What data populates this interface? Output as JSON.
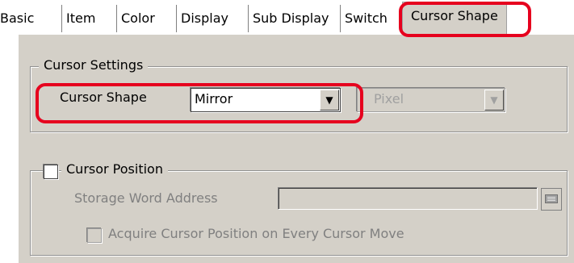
{
  "tabs": [
    {
      "label": "Basic"
    },
    {
      "label": "Item"
    },
    {
      "label": "Color"
    },
    {
      "label": "Display"
    },
    {
      "label": "Sub Display"
    },
    {
      "label": "Switch"
    },
    {
      "label": "Cursor Shape"
    }
  ],
  "cursor_settings": {
    "group_title": "Cursor Settings",
    "shape_label": "Cursor Shape",
    "shape_value": "Mirror",
    "unit_value": "Pixel"
  },
  "cursor_position": {
    "group_title": "Cursor Position",
    "storage_label": "Storage Word Address",
    "storage_value": "",
    "acquire_label": "Acquire Cursor Position on Every Cursor Move"
  },
  "colors": {
    "highlight": "#e6001e",
    "dialog_bg": "#d4d0c8"
  },
  "icons": {
    "combo_arrow": "▼",
    "address_button": "address-input-icon"
  }
}
